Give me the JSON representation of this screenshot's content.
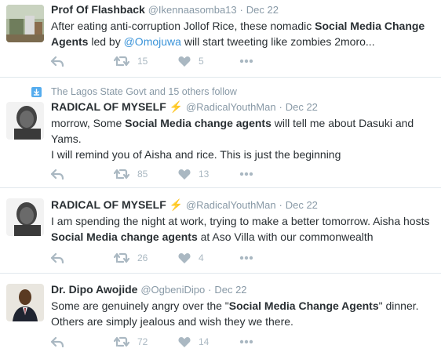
{
  "tweets": [
    {
      "name": "Prof Of Flashback",
      "handle": "@Ikennaasomba13",
      "dot": "·",
      "time": "Dec 22",
      "line1_a": "After eating anti-corruption Jollof Rice, these nomadic ",
      "line1_b": "Social Media Change",
      "line2_a": "Agents",
      "line2_b": " led by ",
      "line2_mention": "@Omojuwa",
      "line2_c": " will start tweeting like zombies 2moro...",
      "retweets": "15",
      "likes": "5"
    },
    {
      "social_context": "The Lagos State Govt and 15 others follow",
      "name": "RADICAL OF MYSELF",
      "bolt": "⚡",
      "handle": "@RadicalYouthMan",
      "dot": "·",
      "time": "Dec 22",
      "line1_a": "morrow, Some ",
      "line1_b": "Social Media change agents",
      "line1_c": " will tell me about Dasuki and",
      "line2": "Yams.",
      "line3": "I will remind you of Aisha and rice. This is just the beginning",
      "retweets": "85",
      "likes": "13"
    },
    {
      "name": "RADICAL OF MYSELF",
      "bolt": "⚡",
      "handle": "@RadicalYouthMan",
      "dot": "·",
      "time": "Dec 22",
      "line1": "I am spending the night at work, trying to make a better tomorrow. Aisha hosts",
      "line2_b": "Social Media change agents",
      "line2_c": " at Aso Villa with our commonwealth",
      "retweets": "26",
      "likes": "4"
    },
    {
      "name": "Dr. Dipo Awojide",
      "handle": "@OgbeniDipo",
      "dot": "·",
      "time": "Dec 22",
      "line1_a": "Some are genuinely angry over the \"",
      "line1_b": "Social Media Change Agents",
      "line1_c": "\" dinner.",
      "line2": "Others are simply jealous and wish they we there.",
      "retweets": "72",
      "likes": "14"
    }
  ],
  "icons": [
    "reply-icon",
    "retweet-icon",
    "heart-icon",
    "more-icon",
    "follow-context-icon",
    "lightning-icon"
  ],
  "colors": {
    "link": "#3b94d9",
    "muted": "#8899a6",
    "action": "#aab8c2",
    "accent": "#55acee",
    "bolt": "#f2a33a"
  }
}
